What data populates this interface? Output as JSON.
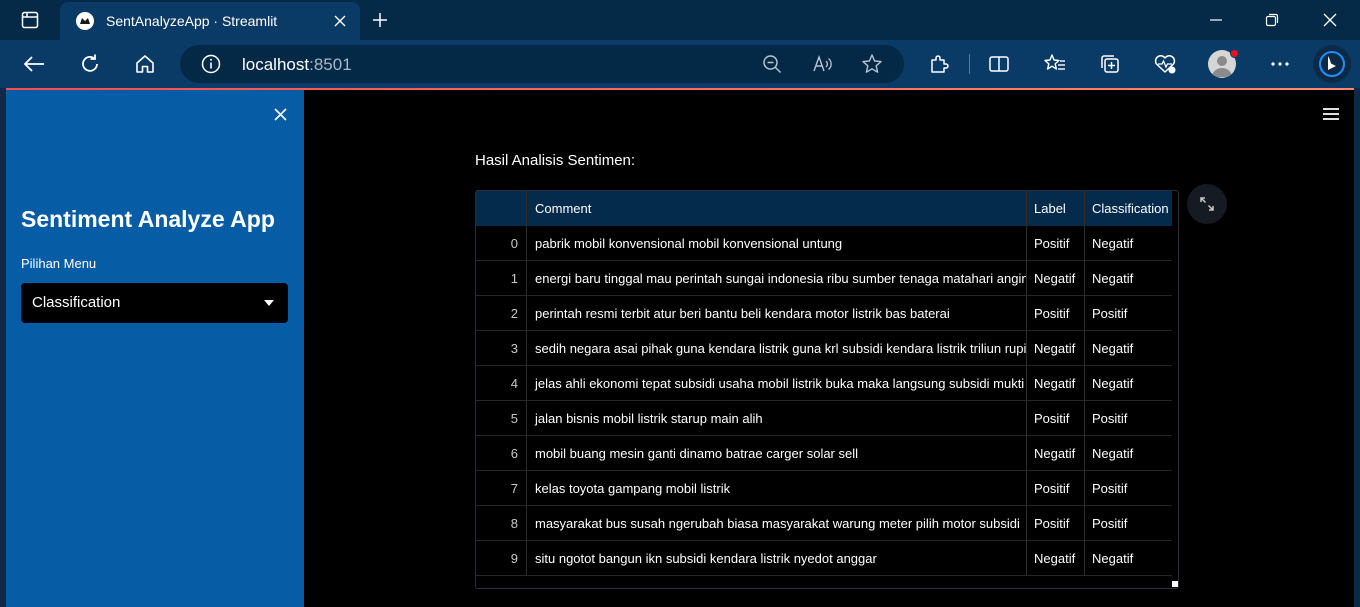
{
  "browser": {
    "tab_title": "SentAnalyzeApp · Streamlit",
    "address_host": "localhost",
    "address_port": ":8501"
  },
  "sidebar": {
    "title": "Sentiment Analyze App",
    "menu_label": "Pilihan Menu",
    "selected_option": "Classification"
  },
  "main": {
    "heading": "Hasil Analisis Sentimen:",
    "table": {
      "columns": [
        "",
        "Comment",
        "Label",
        "Classification"
      ],
      "rows": [
        {
          "idx": "0",
          "comment": "pabrik mobil konvensional mobil konvensional untung",
          "label": "Positif",
          "classification": "Negatif"
        },
        {
          "idx": "1",
          "comment": "energi baru tinggal mau perintah sungai indonesia ribu sumber tenaga matahari angin",
          "label": "Negatif",
          "classification": "Negatif"
        },
        {
          "idx": "2",
          "comment": "perintah resmi terbit atur beri bantu beli kendara motor listrik bas baterai",
          "label": "Positif",
          "classification": "Positif"
        },
        {
          "idx": "3",
          "comment": "sedih negara asai pihak guna kendara listrik guna krl subsidi kendara listrik triliun rupiah",
          "label": "Negatif",
          "classification": "Negatif"
        },
        {
          "idx": "4",
          "comment": "jelas ahli ekonomi tepat subsidi usaha mobil listrik buka maka langsung subsidi mukti",
          "label": "Negatif",
          "classification": "Negatif"
        },
        {
          "idx": "5",
          "comment": "jalan bisnis mobil listrik starup main alih",
          "label": "Positif",
          "classification": "Positif"
        },
        {
          "idx": "6",
          "comment": "mobil buang mesin ganti dinamo batrae carger solar sell",
          "label": "Negatif",
          "classification": "Negatif"
        },
        {
          "idx": "7",
          "comment": "kelas toyota gampang mobil listrik",
          "label": "Positif",
          "classification": "Positif"
        },
        {
          "idx": "8",
          "comment": "masyarakat bus susah ngerubah biasa masyarakat warung meter pilih motor subsidi",
          "label": "Positif",
          "classification": "Positif"
        },
        {
          "idx": "9",
          "comment": "situ ngotot bangun ikn subsidi kendara listrik nyedot anggar",
          "label": "Negatif",
          "classification": "Negatif"
        }
      ]
    }
  }
}
